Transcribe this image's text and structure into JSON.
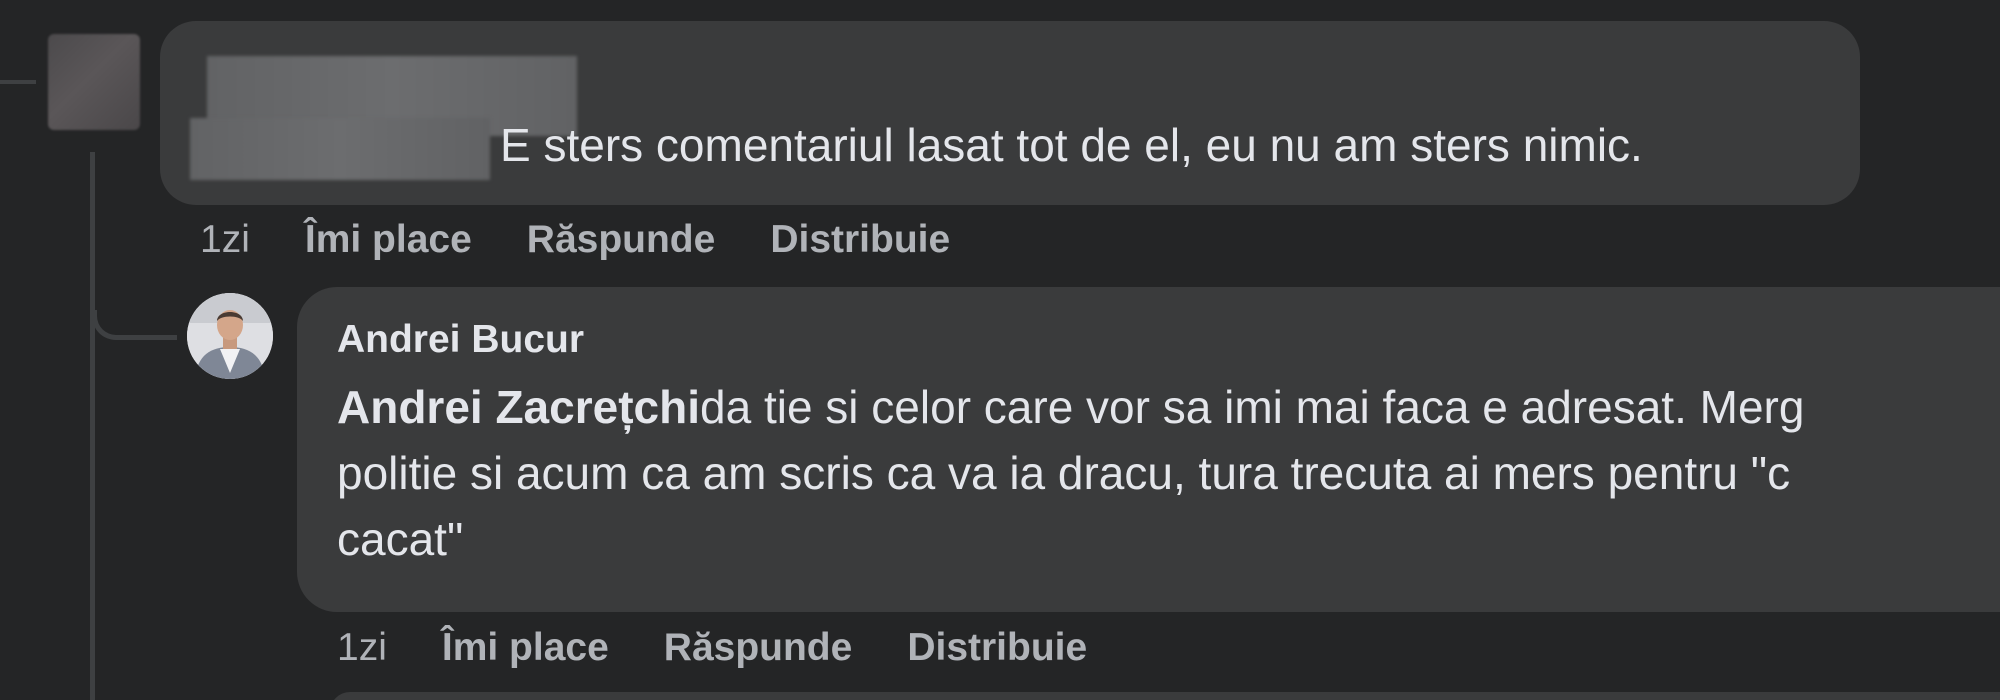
{
  "comment1": {
    "author_redacted": true,
    "text": "E sters comentariul lasat tot de el, eu nu am sters nimic.",
    "actions": {
      "time": "1zi",
      "like": "Îmi place",
      "reply": "Răspunde",
      "share": "Distribuie"
    }
  },
  "comment2": {
    "author": "Andrei Bucur",
    "mention": "Andrei Zacrețchi",
    "text_line1": "da tie si celor care vor sa imi mai faca e adresat. Merg",
    "text_line2": "politie si acum ca am scris ca va ia dracu, tura trecuta ai mers pentru \"c",
    "text_line3": "cacat\"",
    "actions": {
      "time": "1zi",
      "like": "Îmi place",
      "reply": "Răspunde",
      "share": "Distribuie"
    }
  },
  "colors": {
    "background": "#242526",
    "bubble": "#3a3b3c",
    "text_primary": "#e4e6eb",
    "text_secondary": "#b0b3b8",
    "thread_line": "#3e4042"
  }
}
